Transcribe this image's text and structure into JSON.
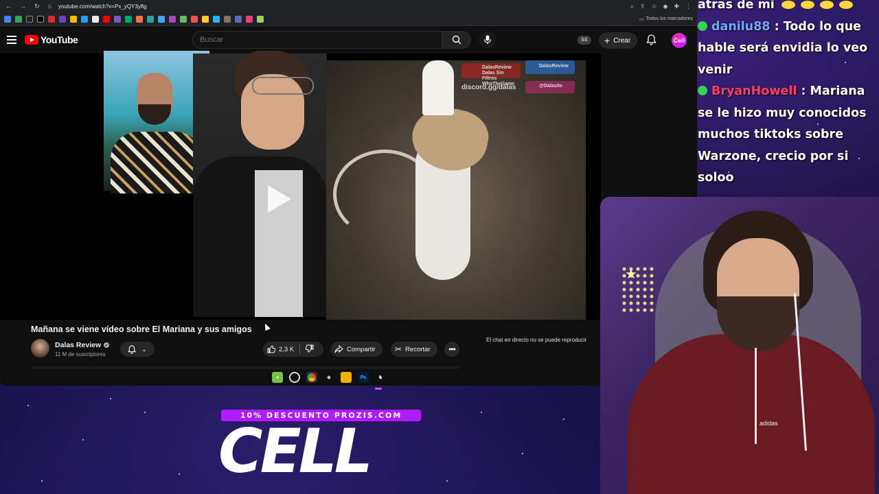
{
  "browser": {
    "url": "youtube.com/watch?v=Px_yQY3yftg",
    "bookmarks_folder": "Todos los marcadores"
  },
  "youtube": {
    "logo_text": "YouTube",
    "search_placeholder": "Buscar",
    "badge": "SS",
    "create_label": "Crear",
    "account_initials": "Cell"
  },
  "video": {
    "title": "Mañana se viene vídeo sobre El Mariana y sus amigos",
    "channel_name": "Dalas Review",
    "subscribers": "11 M de suscriptores",
    "likes": "2,3 K",
    "share_label": "Compartir",
    "clip_label": "Recortar",
    "chat_notice": "El chat en directo no se puede reproducir",
    "overlay": {
      "yt_channel": "DalasReview",
      "yt_second_line": "Dalas Sin Filtros",
      "yt_third_line": "WhoTheGame",
      "twitter": "DalasReview",
      "discord": "discord.gg/dalas",
      "instagram": "@Dalasito"
    }
  },
  "taskbar": {
    "active_app": "Ps"
  },
  "chat": {
    "top_fragment": "atras de mi",
    "messages": [
      {
        "user": "danilu88",
        "text": " : Todo lo que hable será envidia lo veo venir"
      },
      {
        "user": "BryanHowell",
        "text": " : Mariana se le hizo muy conocidos muchos tiktoks sobre Warzone, crecio por si soloo"
      }
    ]
  },
  "promo": {
    "banner": "10% DESCUENTO PROZIS.COM",
    "logo": "CELL"
  },
  "webcam": {
    "hoodie_brand": "adidas"
  },
  "colors": {
    "youtube_red": "#ff0000",
    "promo_purple": "#b01cff",
    "chat_user_blue": "#6fa8ff",
    "chat_user_red": "#ff3d6b"
  }
}
